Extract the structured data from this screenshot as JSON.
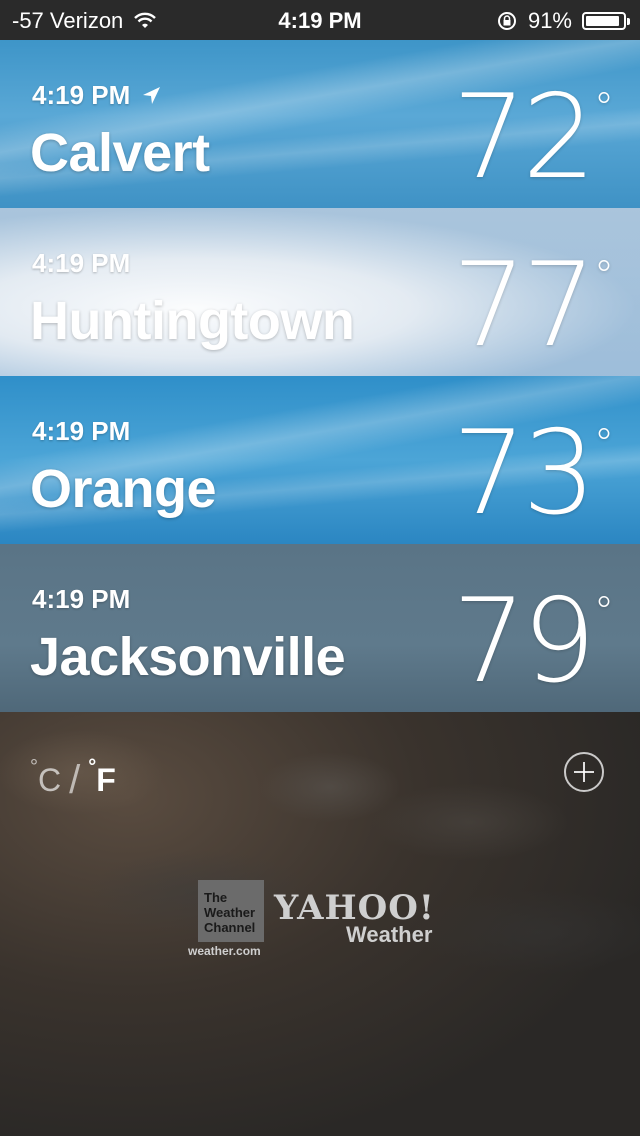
{
  "status_bar": {
    "carrier": "-57 Verizon",
    "time": "4:19 PM",
    "battery": "91%",
    "battery_level": 0.91,
    "icons": [
      "wifi-icon",
      "rotation-lock-icon",
      "battery-icon"
    ]
  },
  "locations": [
    {
      "time": "4:19 PM",
      "city": "Calvert",
      "temp": "72",
      "current_location": true
    },
    {
      "time": "4:19 PM",
      "city": "Huntingtown",
      "temp": "77"
    },
    {
      "time": "4:19 PM",
      "city": "Orange",
      "temp": "73"
    },
    {
      "time": "4:19 PM",
      "city": "Jacksonville",
      "temp": "79"
    }
  ],
  "degree_symbol": "°",
  "units": {
    "celsius": "C",
    "fahrenheit": "F",
    "separator": "/",
    "selected": "F"
  },
  "branding": {
    "twc_logo": "The Weather Channel",
    "twc_url": "weather.com",
    "yahoo": "YAHOO!",
    "yahoo_sub": "Weather"
  }
}
